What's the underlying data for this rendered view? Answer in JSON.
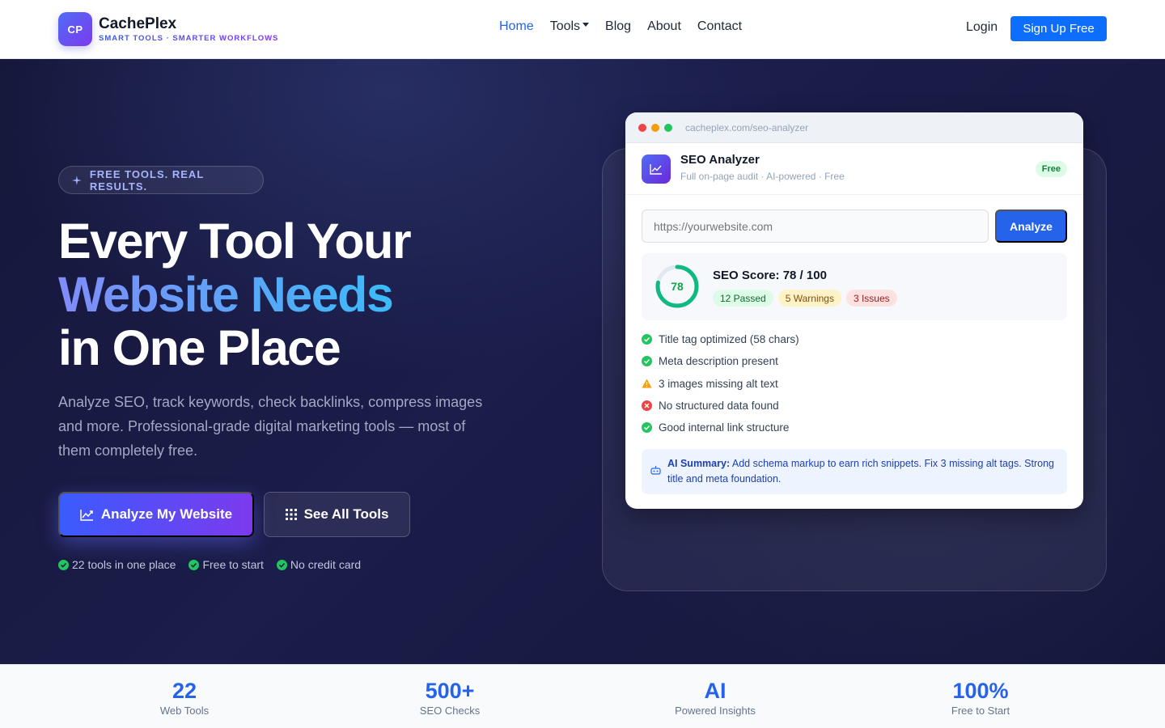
{
  "brand": {
    "logo": "CP",
    "name": "CachePlex",
    "tagline": "SMART TOOLS · SMARTER WORKFLOWS"
  },
  "nav": {
    "links": [
      "Home",
      "Tools",
      "Blog",
      "About",
      "Contact"
    ],
    "active": "Home",
    "login": "Login",
    "signup": "Sign Up Free"
  },
  "hero": {
    "pill": "FREE TOOLS. REAL RESULTS.",
    "title_line1": "Every Tool Your",
    "title_line2": "Website Needs",
    "title_line3": "in One Place",
    "lead": "Analyze SEO, track keywords, check backlinks, compress images and more. Professional-grade digital marketing tools — most of them completely free.",
    "primary_button": "Analyze My Website",
    "secondary_button": "See All Tools",
    "checks": [
      "22 tools in one place",
      "Free to start",
      "No credit card"
    ]
  },
  "mockup": {
    "url": "cacheplex.com/seo-analyzer",
    "tool_title": "SEO Analyzer",
    "tool_subtitle": "Full on-page audit · AI-powered · Free",
    "badge": "Free",
    "input_placeholder": "https://yourwebsite.com",
    "analyze_button": "Analyze",
    "score": 78,
    "score_title": "SEO Score: 78 / 100",
    "badges": {
      "passed": "12 Passed",
      "warnings": "5 Warnings",
      "issues": "3 Issues"
    },
    "checklist": [
      {
        "status": "pass",
        "text": "Title tag optimized (58 chars)"
      },
      {
        "status": "pass",
        "text": "Meta description present"
      },
      {
        "status": "warn",
        "text": "3 images missing alt text"
      },
      {
        "status": "fail",
        "text": "No structured data found"
      },
      {
        "status": "pass",
        "text": "Good internal link structure"
      }
    ],
    "summary_label": "AI Summary:",
    "summary_text": " Add schema markup to earn rich snippets. Fix 3 missing alt tags. Strong title and meta foundation."
  },
  "stats": [
    {
      "value": "22",
      "label": "Web Tools"
    },
    {
      "value": "500+",
      "label": "SEO Checks"
    },
    {
      "value": "AI",
      "label": "Powered Insights"
    },
    {
      "value": "100%",
      "label": "Free to Start"
    }
  ],
  "colors": {
    "accent": "#2563eb",
    "hero_bg": "#1b1d4a",
    "pass": "#22c55e",
    "warn": "#f59e0b",
    "fail": "#ef4444"
  }
}
